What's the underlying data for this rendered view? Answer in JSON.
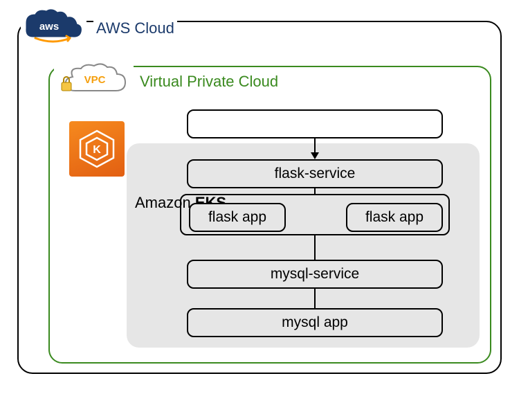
{
  "aws": {
    "label": "AWS Cloud",
    "logo_text": "aws"
  },
  "vpc": {
    "label": "Virtual Private Cloud",
    "badge_text": "VPC"
  },
  "eks": {
    "label_prefix": "Amazon ",
    "label_bold": "EKS",
    "icon_letter": "K"
  },
  "nodes": {
    "top_empty": "",
    "flask_service": "flask-service",
    "flask_app_1": "flask app",
    "flask_app_2": "flask app",
    "mysql_service": "mysql-service",
    "mysql_app": "mysql app"
  },
  "colors": {
    "aws_navy": "#1b3a6b",
    "aws_orange": "#ff9900",
    "vpc_green": "#3a8a1f",
    "eks_orange": "#e25f12",
    "eks_bg": "#e6e6e6"
  }
}
